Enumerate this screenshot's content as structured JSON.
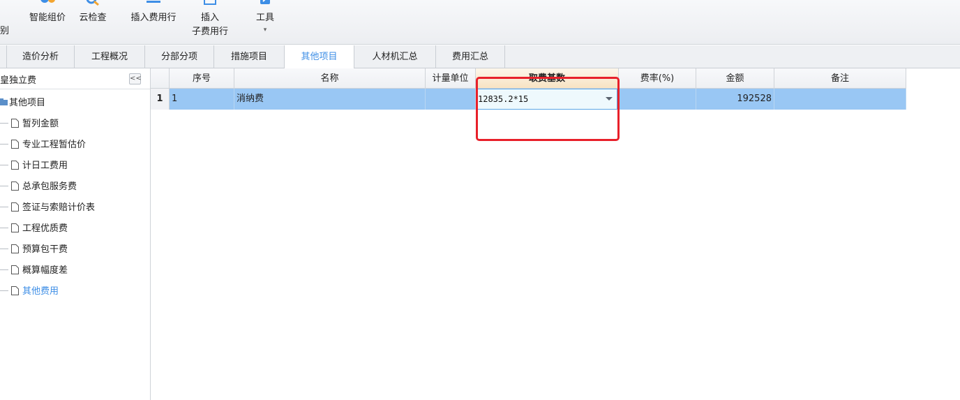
{
  "ribbon": {
    "edge_label": "别",
    "buttons": [
      {
        "label": "智能组价"
      },
      {
        "label": "云检查"
      },
      {
        "label": "插入费用行"
      },
      {
        "label": "插入",
        "label2": "子费用行"
      },
      {
        "label": "工具",
        "label2": "▾"
      }
    ]
  },
  "tabs": [
    {
      "label": "造价分析"
    },
    {
      "label": "工程概况"
    },
    {
      "label": "分部分项"
    },
    {
      "label": "措施项目"
    },
    {
      "label": "其他项目",
      "active": true
    },
    {
      "label": "人材机汇总"
    },
    {
      "label": "费用汇总"
    }
  ],
  "left_panel": {
    "title": "皇独立费",
    "collapse": "<<",
    "root": "其他项目",
    "items": [
      {
        "label": "暂列金额"
      },
      {
        "label": "专业工程暂估价"
      },
      {
        "label": "计日工费用"
      },
      {
        "label": "总承包服务费"
      },
      {
        "label": "签证与索赔计价表"
      },
      {
        "label": "工程优质费"
      },
      {
        "label": "预算包干费"
      },
      {
        "label": "概算幅度差"
      },
      {
        "label": "其他费用",
        "active": true
      }
    ]
  },
  "grid": {
    "headers": {
      "seq": "序号",
      "name": "名称",
      "unit": "计量单位",
      "base": "取费基数",
      "rate": "费率(%)",
      "amount": "金额",
      "remark": "备注"
    },
    "rows": [
      {
        "rownum": "1",
        "seq": "1",
        "name": "消纳费",
        "unit": "",
        "base": "12835.2*15",
        "rate": "",
        "amount": "192528",
        "remark": ""
      }
    ]
  },
  "colors": {
    "accent": "#3d8ee6",
    "selected_row": "#99c7f4",
    "highlight_box": "#e8202a"
  }
}
